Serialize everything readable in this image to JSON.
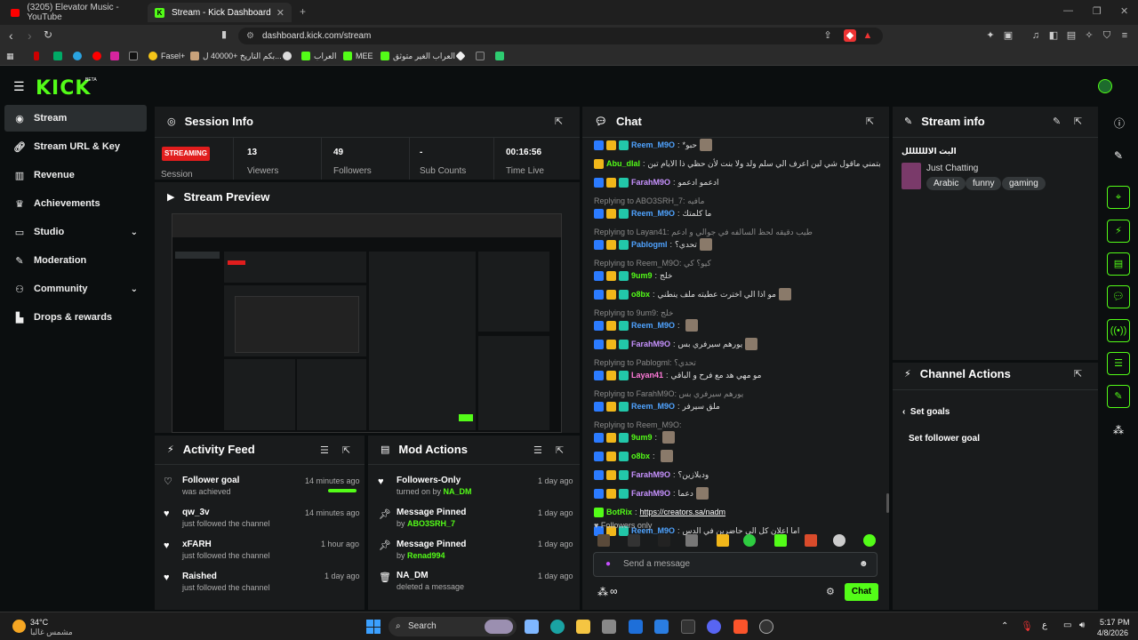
{
  "browser": {
    "tabs": [
      {
        "label": "(3205) Elevator Music - YouTube"
      },
      {
        "label": "Stream - Kick Dashboard"
      }
    ],
    "new_tab": "+",
    "url": "dashboard.kick.com/stream",
    "bookmarks": [
      {
        "label": "Fasel+"
      },
      {
        "label": "بكم التاريخ +40000 ل..."
      },
      {
        "label": "العراب"
      },
      {
        "label": "MEE"
      },
      {
        "label": "العراب الغير متوثق"
      }
    ]
  },
  "app": {
    "logo": "KICK",
    "beta": "BETA"
  },
  "sidebar": {
    "items": [
      {
        "label": "Stream",
        "icon": "broadcast-icon"
      },
      {
        "label": "Stream URL & Key",
        "icon": "link-icon"
      },
      {
        "label": "Revenue",
        "icon": "chart-icon"
      },
      {
        "label": "Achievements",
        "icon": "trophy-icon"
      },
      {
        "label": "Studio",
        "icon": "monitor-icon"
      },
      {
        "label": "Moderation",
        "icon": "wrench-icon"
      },
      {
        "label": "Community",
        "icon": "users-icon"
      },
      {
        "label": "Drops & rewards",
        "icon": "gift-icon"
      }
    ]
  },
  "session_info": {
    "title": "Session Info",
    "status": "STREAMING",
    "status_label": "Session",
    "stats": [
      {
        "value": "13",
        "label": "Viewers"
      },
      {
        "value": "49",
        "label": "Followers"
      },
      {
        "value": "-",
        "label": "Sub Counts"
      },
      {
        "value": "00:16:56",
        "label": "Time Live"
      }
    ]
  },
  "stream_preview": {
    "title": "Stream Preview"
  },
  "activity_feed": {
    "title": "Activity Feed",
    "items": [
      {
        "title": "Follower goal",
        "sub": "was achieved",
        "time": "14 minutes ago",
        "progress": 1.0
      },
      {
        "title": "qw_3v",
        "sub": "just followed the channel",
        "time": "14 minutes ago"
      },
      {
        "title": "xFARH",
        "sub": "just followed the channel",
        "time": "1 hour ago"
      },
      {
        "title": "Raished",
        "sub": "just followed the channel",
        "time": "1 day ago"
      }
    ]
  },
  "mod_actions": {
    "title": "Mod Actions",
    "items": [
      {
        "title": "Followers-Only",
        "sub_prefix": "turned on by ",
        "user": "NA_DM",
        "time": "1 day ago"
      },
      {
        "title": "Message Pinned",
        "sub_prefix": "by ",
        "user": "ABO3SRH_7",
        "time": "1 day ago"
      },
      {
        "title": "Message Pinned",
        "sub_prefix": "by ",
        "user": "Renad994",
        "time": "1 day ago"
      },
      {
        "title": "NA_DM",
        "sub_prefix": "deleted a message",
        "user": "",
        "time": "1 day ago"
      }
    ]
  },
  "chat": {
    "title": "Chat",
    "lines": [
      {
        "user": "Reem_M9O",
        "color": "blue",
        "msg": "*حبو"
      },
      {
        "user": "Abu_dlal",
        "color": "green",
        "msg": "بتمني ماقول شي لين اعرف الي سلم ولد ولا بنت لأن حظي ذا الايام تبن"
      },
      {
        "user": "FarahM9O",
        "color": "purple",
        "msg": "ادعمو ادعمو"
      },
      {
        "reply": "Replying to ABO3SRH_7: مافيه"
      },
      {
        "user": "Reem_M9O",
        "color": "blue",
        "msg": "ما كلمتك"
      },
      {
        "reply": "Replying to Layan41: طيب دقيقه لحظ السالفه في جوالي و ادعم"
      },
      {
        "user": "Pablogml",
        "color": "blue",
        "msg": "تحدي؟"
      },
      {
        "reply": "Replying to Reem_M9O: كيو؟ كي"
      },
      {
        "user": "9um9",
        "color": "green",
        "msg": "خلج"
      },
      {
        "user": "o8bx",
        "color": "green",
        "msg": "مو اذا الي اخترت عطيته ملف ينطني"
      },
      {
        "reply": "Replying to 9um9: خلج"
      },
      {
        "user": "Reem_M9O",
        "color": "blue",
        "msg": ""
      },
      {
        "user": "FarahM9O",
        "color": "purple",
        "msg": "يورهم سيرفري بس"
      },
      {
        "reply": "Replying to Pablogml: تحدي؟"
      },
      {
        "user": "Layan41",
        "color": "pink",
        "msg": "مو مهي هد مع فرح و الباقي"
      },
      {
        "reply": "Replying to FarahM9O: يورهم سيرفري بس"
      },
      {
        "user": "Reem_M9O",
        "color": "blue",
        "msg": "ملق سيرفر"
      },
      {
        "reply": "Replying to Reem_M9O:"
      },
      {
        "user": "9um9",
        "color": "green",
        "msg": ""
      },
      {
        "user": "o8bx",
        "color": "green",
        "msg": ""
      },
      {
        "user": "FarahM9O",
        "color": "purple",
        "msg": "ودبلازين؟"
      },
      {
        "user": "FarahM9O",
        "color": "purple",
        "msg": "دعما"
      },
      {
        "user": "BotRix",
        "color": "green",
        "msg": "https://creators.sa/nadm"
      },
      {
        "user": "Reem_M9O",
        "color": "blue",
        "msg": "اما اعلان كل الي حاضرين في الدس"
      }
    ],
    "followers_only": "Followers only",
    "input_placeholder": "Send a message",
    "send_label": "Chat"
  },
  "stream_info": {
    "title": "Stream info",
    "stream_title": "البث الاللللللل",
    "category": "Just Chatting",
    "tags": [
      "Arabic",
      "funny",
      "gaming"
    ]
  },
  "channel_actions": {
    "title": "Channel Actions",
    "back_label": "Set goals",
    "action": "Set follower goal"
  },
  "taskbar": {
    "weather_temp": "34°C",
    "weather_desc": "مشمس غالبا",
    "search_label": "Search",
    "lang": "ع",
    "time": "5:17 PM",
    "date": "4/8/2026"
  },
  "colors": {
    "accent": "#53fc18",
    "streaming": "#e11d1d",
    "panel": "#191b1c",
    "bg": "#0b0e0f"
  }
}
